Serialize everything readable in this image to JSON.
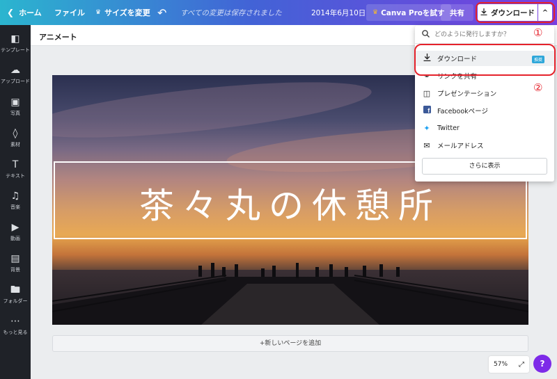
{
  "topbar": {
    "home_label": "ホーム",
    "file_label": "ファイル",
    "resize_label": "サイズを変更",
    "saved_status": "すべての変更は保存されました",
    "doc_date": "2014年6月10日",
    "pro_label": "Canva Proを試す",
    "share_label": "共有",
    "download_label": "ダウンロード"
  },
  "sidebar": {
    "items": [
      {
        "label": "テンプレート",
        "icon": "template-icon"
      },
      {
        "label": "アップロード",
        "icon": "upload-icon"
      },
      {
        "label": "写真",
        "icon": "photo-icon"
      },
      {
        "label": "素材",
        "icon": "elements-icon"
      },
      {
        "label": "テキスト",
        "icon": "text-icon"
      },
      {
        "label": "音楽",
        "icon": "music-icon"
      },
      {
        "label": "動画",
        "icon": "video-icon"
      },
      {
        "label": "背景",
        "icon": "background-icon"
      },
      {
        "label": "フォルダー",
        "icon": "folder-icon"
      },
      {
        "label": "もっと見る",
        "icon": "more-icon"
      }
    ]
  },
  "editor": {
    "doc_title": "アニメート",
    "design_title": "茶々丸の休憩所",
    "add_page_label": "+新しいページを追加",
    "zoom_level": "57%",
    "help_label": "?"
  },
  "dropdown": {
    "search_placeholder": "どのように発行しますか？",
    "items": [
      {
        "label": "ダウンロード",
        "icon": "download-icon",
        "badge": "推奨"
      },
      {
        "label": "リンクを共有",
        "icon": "link-icon"
      },
      {
        "label": "プレゼンテーション",
        "icon": "presentation-icon"
      },
      {
        "label": "Facebookページ",
        "icon": "facebook-icon"
      },
      {
        "label": "Twitter",
        "icon": "twitter-icon"
      },
      {
        "label": "メールアドレス",
        "icon": "mail-icon"
      }
    ],
    "more_label": "さらに表示"
  },
  "annotations": {
    "marker_1": "①",
    "marker_2": "②",
    "color": "#e5222b"
  },
  "colors": {
    "accent": "#7d2ae8",
    "sidebar_bg": "#1f2228"
  }
}
